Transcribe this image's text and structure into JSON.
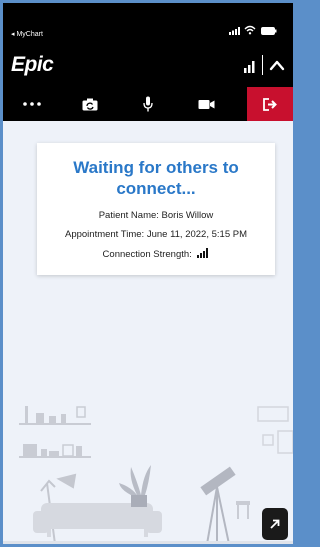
{
  "status_bar": {
    "back_label": "◂ MyChart"
  },
  "header": {
    "logo_text": "Epic"
  },
  "controls": [
    {
      "name": "more-options-button",
      "icon": "ellipsis-icon"
    },
    {
      "name": "switch-camera-button",
      "icon": "camera-rotate-icon"
    },
    {
      "name": "microphone-button",
      "icon": "microphone-icon"
    },
    {
      "name": "video-button",
      "icon": "video-camera-icon"
    },
    {
      "name": "leave-call-button",
      "icon": "exit-icon",
      "color": "#c8102e"
    }
  ],
  "card": {
    "title": "Waiting for others to connect...",
    "patient_line": "Patient Name: Boris Willow",
    "appointment_line": "Appointment Time: June 11, 2022, 5:15 PM",
    "strength_label": "Connection Strength:"
  },
  "colors": {
    "accent": "#2a78c8",
    "danger": "#c8102e",
    "background": "#eef2f9",
    "frame": "#5b8fc9"
  }
}
